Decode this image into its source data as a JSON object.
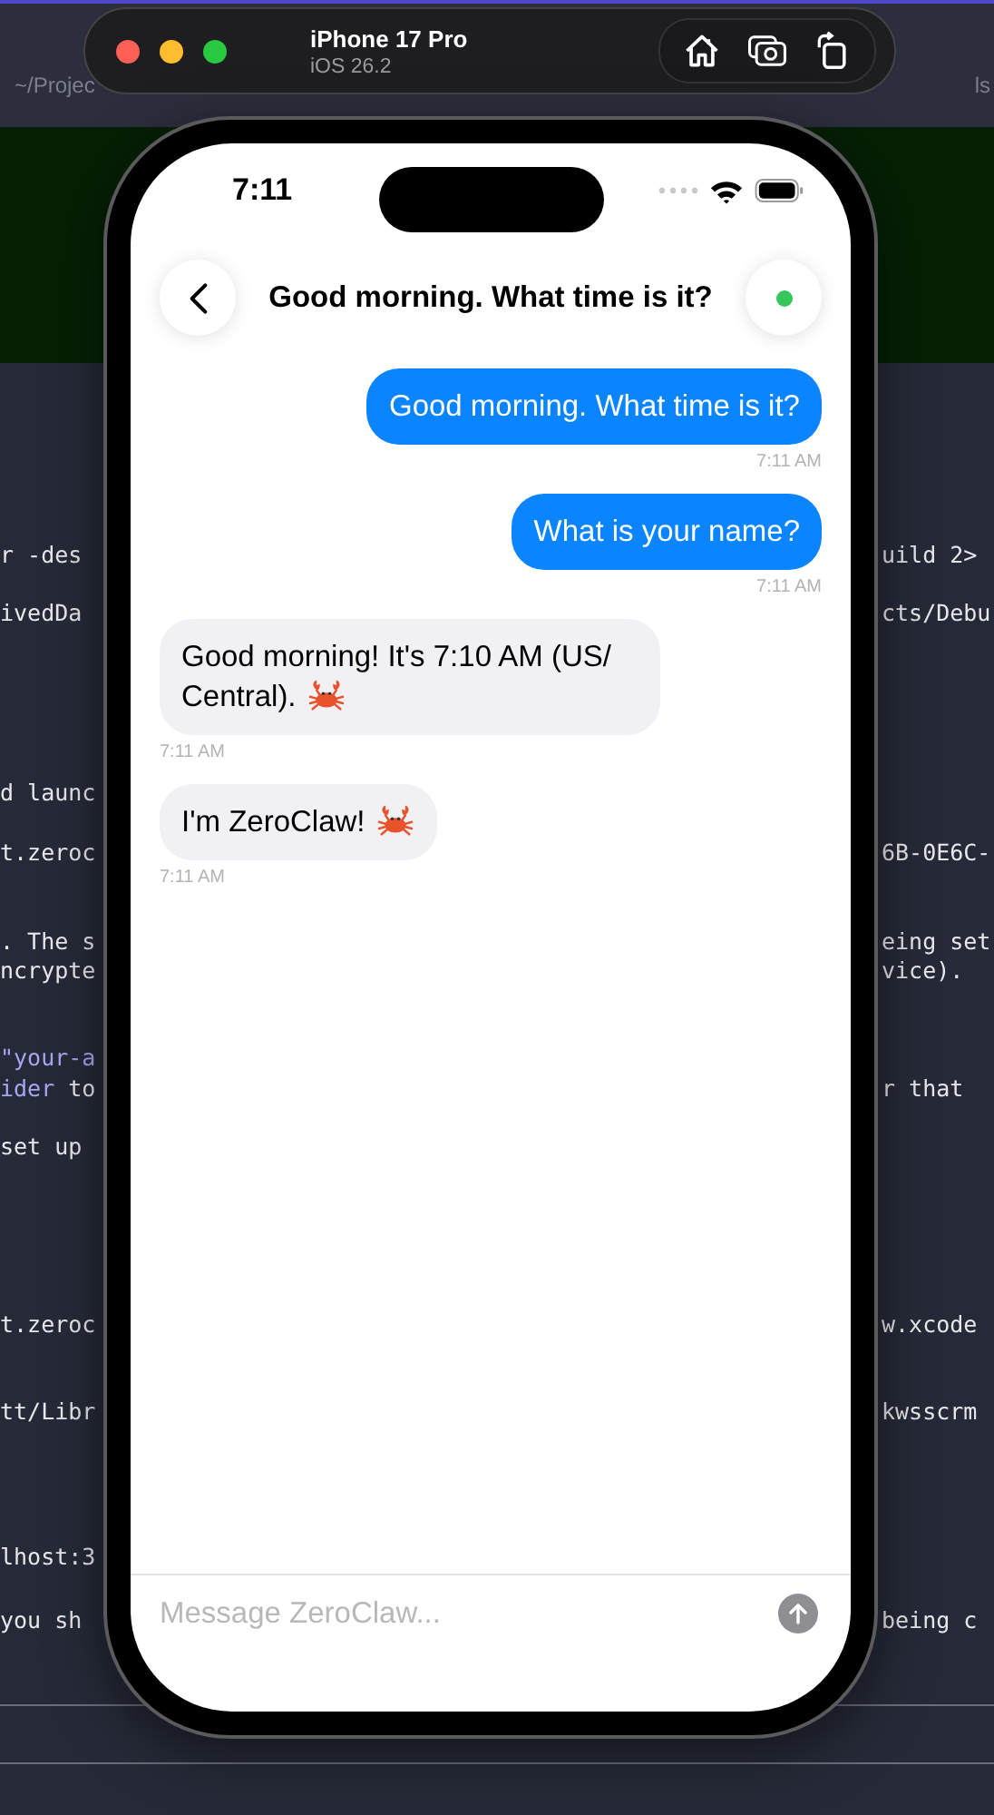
{
  "simulator": {
    "device": "iPhone 17 Pro",
    "os": "iOS 26.2"
  },
  "terminal": {
    "tab_left": "~/Projec",
    "tab_right": "ls",
    "lines": [
      {
        "left": [
          {
            "text": "r -des",
            "kind": "plain"
          }
        ],
        "right": "uild 2>"
      },
      {
        "left": [
          {
            "text": "ivedDa",
            "kind": "plain"
          }
        ],
        "right": "cts/Debu"
      },
      {
        "left": [
          {
            "text": "d launc",
            "kind": "plain"
          }
        ]
      },
      {
        "left": [
          {
            "text": "t.zeroc",
            "kind": "plain"
          }
        ],
        "right": "6B-0E6C-"
      },
      {
        "left": [
          {
            "text": ". The s",
            "kind": "plain"
          }
        ],
        "right": "eing set"
      },
      {
        "left": [
          {
            "text": "ncrypte",
            "kind": "plain"
          }
        ],
        "right": "vice)."
      },
      {
        "left": [
          {
            "text": "\"your-a",
            "kind": "string"
          }
        ]
      },
      {
        "left": [
          {
            "text": "ider",
            "kind": "string"
          },
          {
            "text": "to",
            "kind": "plain"
          }
        ],
        "right": "r that"
      },
      {
        "left": [
          {
            "text": "set up",
            "kind": "plain"
          }
        ]
      },
      {
        "left": [
          {
            "text": "t.zeroc",
            "kind": "plain"
          }
        ],
        "right": "w.xcode"
      },
      {
        "left": [
          {
            "text": "tt/Libr",
            "kind": "plain"
          }
        ],
        "right": "kwsscrm"
      },
      {
        "left": [
          {
            "text": "lhost:3",
            "kind": "plain"
          }
        ]
      },
      {
        "left": [
          {
            "text": "you sh",
            "kind": "plain"
          }
        ],
        "right": "being c"
      }
    ]
  },
  "phone": {
    "status_bar": {
      "time": "7:11"
    },
    "chat": {
      "title": "Good morning. What time is it?",
      "connected": true,
      "messages": [
        {
          "kind": "user",
          "text": "Good morning. What time is it?",
          "time": "7:11 AM",
          "crab": false
        },
        {
          "kind": "user",
          "text": "What is your name?",
          "time": "7:11 AM",
          "crab": false
        },
        {
          "kind": "assistant",
          "text": "Good morning! It's 7:10 AM (US/ Central).",
          "time": "7:11 AM",
          "crab": true
        },
        {
          "kind": "assistant",
          "text": "I'm ZeroClaw!",
          "time": "7:11 AM",
          "crab": true
        }
      ],
      "input": {
        "placeholder": "Message ZeroClaw..."
      }
    }
  }
}
